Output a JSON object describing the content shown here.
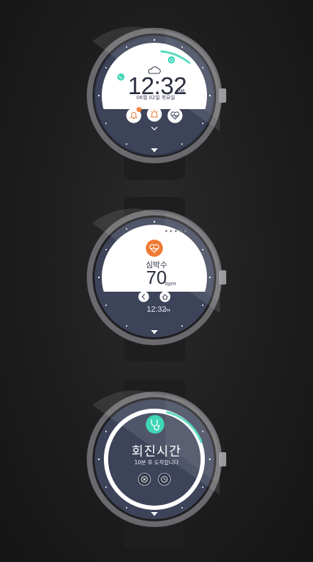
{
  "watch_home": {
    "weather_icon": "cloud-icon",
    "time": "12:32",
    "ampm": "PM",
    "date": "06월 02일 목요일",
    "apps": [
      "bell-icon",
      "siren-icon",
      "heart-rate-icon"
    ],
    "notification_badge": "!",
    "more_icon": "chevron-down-icon",
    "ring_icons": [
      "phone-icon",
      "power-icon"
    ]
  },
  "watch_heart": {
    "icon": "heart-rate-icon",
    "label": "심박수",
    "value": "70",
    "unit": "bpm",
    "back_icon": "chevron-left-icon",
    "home_icon": "home-icon",
    "time": "12:32",
    "ampm": "PM"
  },
  "watch_rounds": {
    "icon": "stethoscope-icon",
    "title": "회진시간",
    "subtitle": "10분 후 도착합니다",
    "dismiss_icon": "close-icon",
    "snooze_icon": "clock-icon"
  },
  "colors": {
    "accent_teal": "#3fd6b6",
    "accent_orange": "#f07a35",
    "dial_dark": "#3d4359",
    "face_white": "#ffffff",
    "bezel": "#6f6f73"
  }
}
